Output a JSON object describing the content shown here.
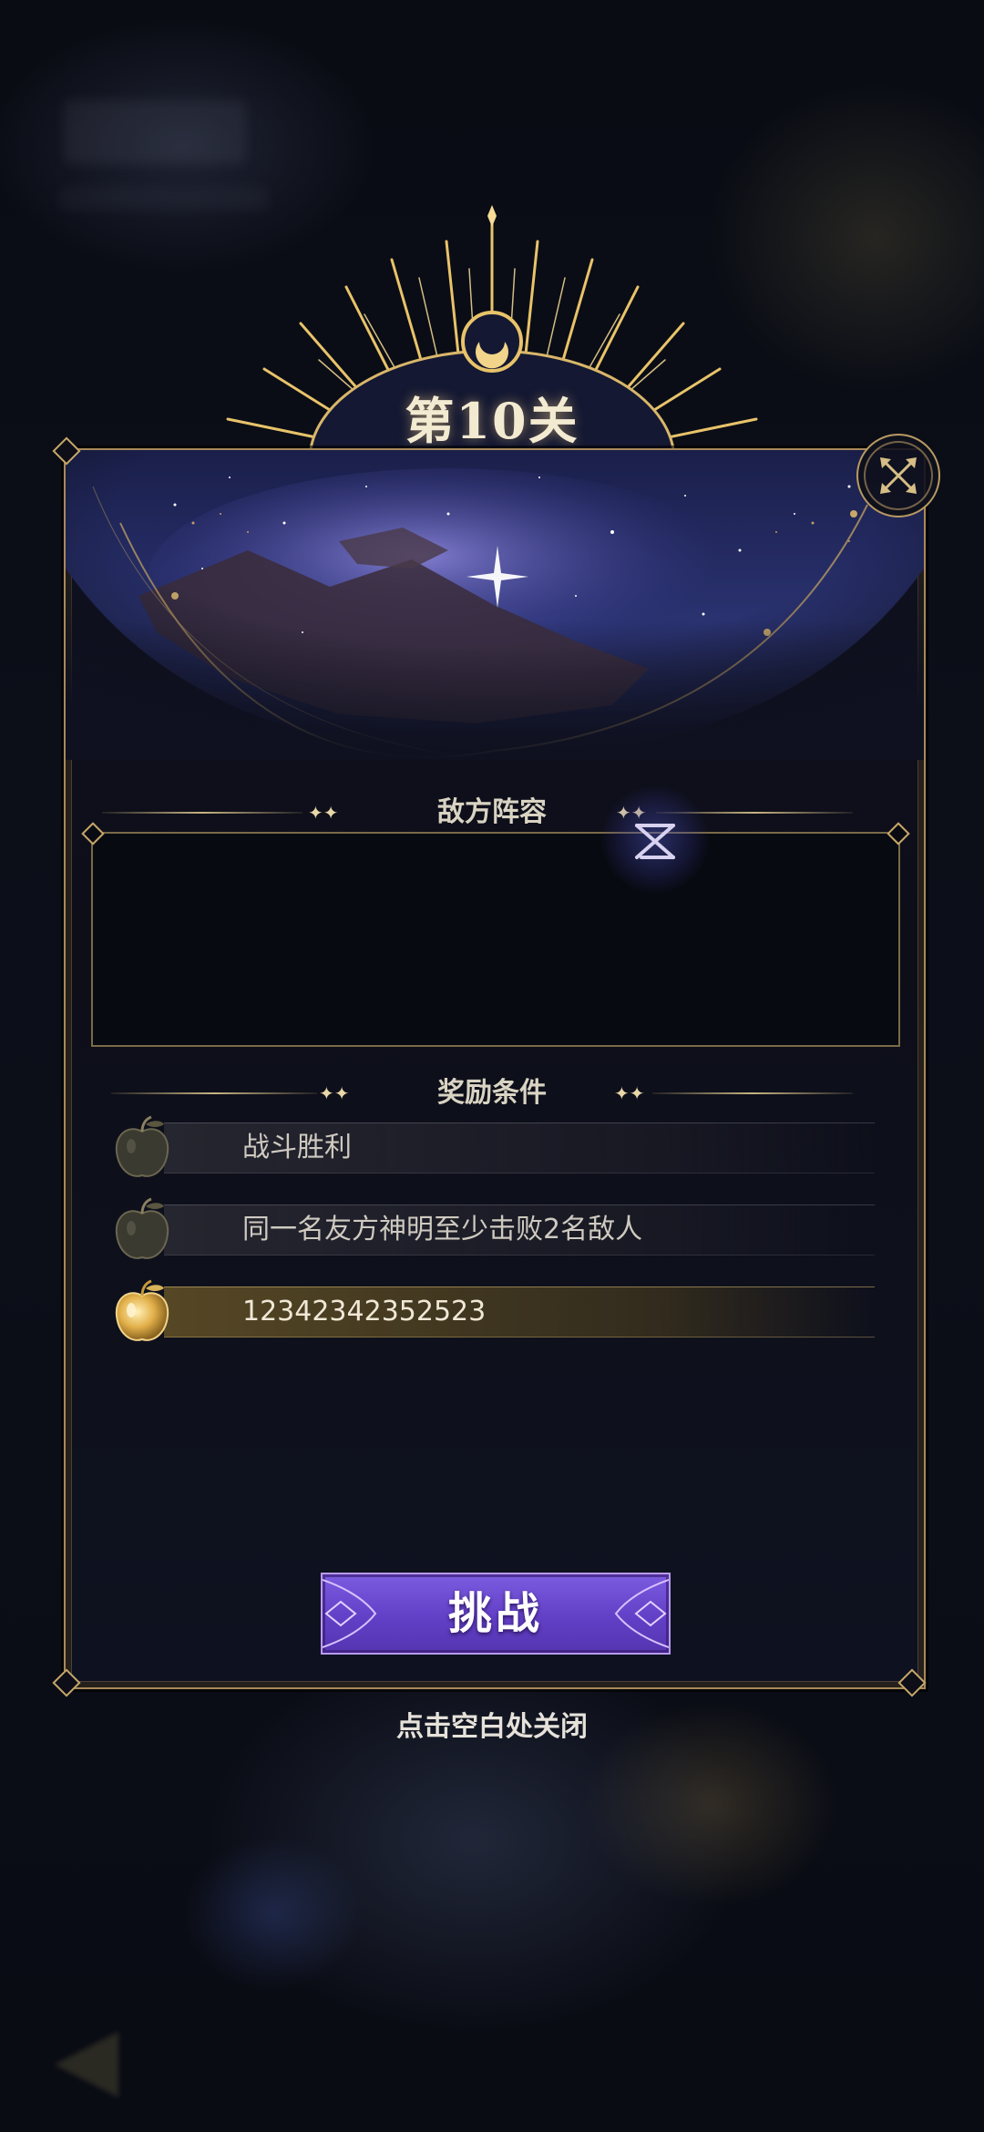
{
  "stage": {
    "title": "第10关"
  },
  "enemy_section": {
    "title": "敌方阵容"
  },
  "reward_section": {
    "title": "奖励条件",
    "conditions": [
      {
        "text": "战斗胜利",
        "achieved": false
      },
      {
        "text": "同一名友方神明至少击败2名敌人",
        "achieved": false
      },
      {
        "text": "12342342352523",
        "achieved": true
      }
    ]
  },
  "challenge_button": {
    "label": "挑战"
  },
  "close_hint": "点击空白处关闭",
  "colors": {
    "gold": "#c8a86a",
    "button_purple": "#6a48d0",
    "panel_bg": "#0e1020"
  }
}
